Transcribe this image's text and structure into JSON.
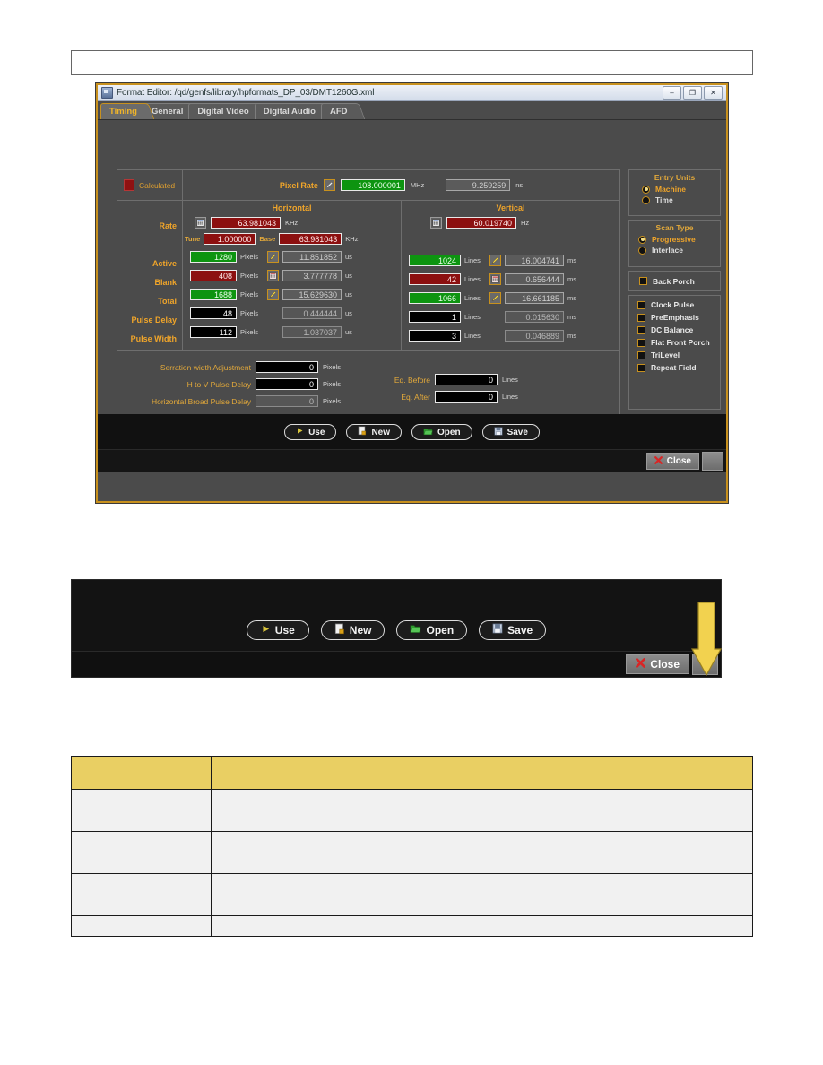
{
  "window": {
    "title": "Format Editor: /qd/genfs/library/hpformats_DP_03/DMT1260G.xml",
    "icon": "window-icon",
    "minimize": "–",
    "maximize": "❐",
    "close": "✕"
  },
  "tabs": [
    {
      "label": "Timing",
      "active": true
    },
    {
      "label": "General",
      "active": false
    },
    {
      "label": "Digital Video",
      "active": false
    },
    {
      "label": "Digital Audio",
      "active": false
    },
    {
      "label": "AFD",
      "active": false
    }
  ],
  "legend": {
    "calculated_label": "Calculated",
    "calculated_color": "#8c1010"
  },
  "pixel_rate": {
    "label": "Pixel Rate",
    "value": "108.000001",
    "unit": "MHz",
    "time_value": "9.259259",
    "time_unit": "ns"
  },
  "columns": {
    "horizontal": "Horizontal",
    "vertical": "Vertical"
  },
  "row_labels": {
    "rate": "Rate",
    "active": "Active",
    "blank": "Blank",
    "total": "Total",
    "pulse_delay": "Pulse Delay",
    "pulse_width": "Pulse Width"
  },
  "horizontal": {
    "rate": {
      "value": "63.981043",
      "unit": "KHz"
    },
    "tune": {
      "label": "Tune",
      "value": "1.000000"
    },
    "base": {
      "label": "Base",
      "value": "63.981043",
      "unit": "KHz"
    },
    "active": {
      "value": "1280",
      "unit": "Pixels",
      "time": "11.851852",
      "time_unit": "us"
    },
    "blank": {
      "value": "408",
      "unit": "Pixels",
      "time": "3.777778",
      "time_unit": "us"
    },
    "total": {
      "value": "1688",
      "unit": "Pixels",
      "time": "15.629630",
      "time_unit": "us"
    },
    "pulse_delay": {
      "value": "48",
      "unit": "Pixels",
      "time": "0.444444",
      "time_unit": "us"
    },
    "pulse_width": {
      "value": "112",
      "unit": "Pixels",
      "time": "1.037037",
      "time_unit": "us"
    }
  },
  "vertical": {
    "rate": {
      "value": "60.019740",
      "unit": "Hz"
    },
    "active": {
      "value": "1024",
      "unit": "Lines",
      "time": "16.004741",
      "time_unit": "ms"
    },
    "blank": {
      "value": "42",
      "unit": "Lines",
      "time": "0.656444",
      "time_unit": "ms"
    },
    "total": {
      "value": "1066",
      "unit": "Lines",
      "time": "16.661185",
      "time_unit": "ms"
    },
    "pulse_delay": {
      "value": "1",
      "unit": "Lines",
      "time": "0.015630",
      "time_unit": "ms"
    },
    "pulse_width": {
      "value": "3",
      "unit": "Lines",
      "time": "0.046889",
      "time_unit": "ms"
    }
  },
  "extra_fields": {
    "serration": {
      "label": "Serration width Adjustment",
      "value": "0",
      "unit": "Pixels"
    },
    "h_to_v": {
      "label": "H to V Pulse Delay",
      "value": "0",
      "unit": "Pixels"
    },
    "h_broad": {
      "label": "Horizontal Broad Pulse Delay",
      "value": "0",
      "unit": "Pixels"
    },
    "eq_before": {
      "label": "Eq. Before",
      "value": "0",
      "unit": "Lines"
    },
    "eq_after": {
      "label": "Eq. After",
      "value": "0",
      "unit": "Lines"
    }
  },
  "entry_units": {
    "title": "Entry Units",
    "options": [
      {
        "label": "Machine",
        "selected": true
      },
      {
        "label": "Time",
        "selected": false
      }
    ]
  },
  "scan_type": {
    "title": "Scan Type",
    "options": [
      {
        "label": "Progressive",
        "selected": true
      },
      {
        "label": "Interlace",
        "selected": false
      }
    ]
  },
  "back_porch": {
    "label": "Back Porch",
    "checked": false
  },
  "checkboxes": [
    {
      "label": "Clock Pulse",
      "checked": false
    },
    {
      "label": "PreEmphasis",
      "checked": false
    },
    {
      "label": "DC Balance",
      "checked": false
    },
    {
      "label": "Flat Front Porch",
      "checked": false
    },
    {
      "label": "TriLevel",
      "checked": false
    },
    {
      "label": "Repeat Field",
      "checked": false
    }
  ],
  "footer_buttons": [
    {
      "label": "Use",
      "icon": "play-icon"
    },
    {
      "label": "New",
      "icon": "new-document-icon"
    },
    {
      "label": "Open",
      "icon": "open-folder-icon"
    },
    {
      "label": "Save",
      "icon": "floppy-save-icon"
    }
  ],
  "close_button": {
    "label": "Close",
    "icon": "close-x-icon"
  },
  "callout": {
    "buttons": [
      {
        "label": "Use",
        "icon": "play-icon"
      },
      {
        "label": "New",
        "icon": "new-document-icon"
      },
      {
        "label": "Open",
        "icon": "open-folder-icon"
      },
      {
        "label": "Save",
        "icon": "floppy-save-icon"
      }
    ],
    "close_button": {
      "label": "Close",
      "icon": "close-x-icon"
    },
    "arrow": {
      "icon": "down-arrow-callout",
      "color": "#f0d250"
    }
  },
  "bottom_table": {
    "header": [
      "",
      ""
    ],
    "rows": [
      [
        "",
        ""
      ],
      [
        "",
        ""
      ],
      [
        "",
        ""
      ],
      [
        "",
        ""
      ]
    ]
  }
}
